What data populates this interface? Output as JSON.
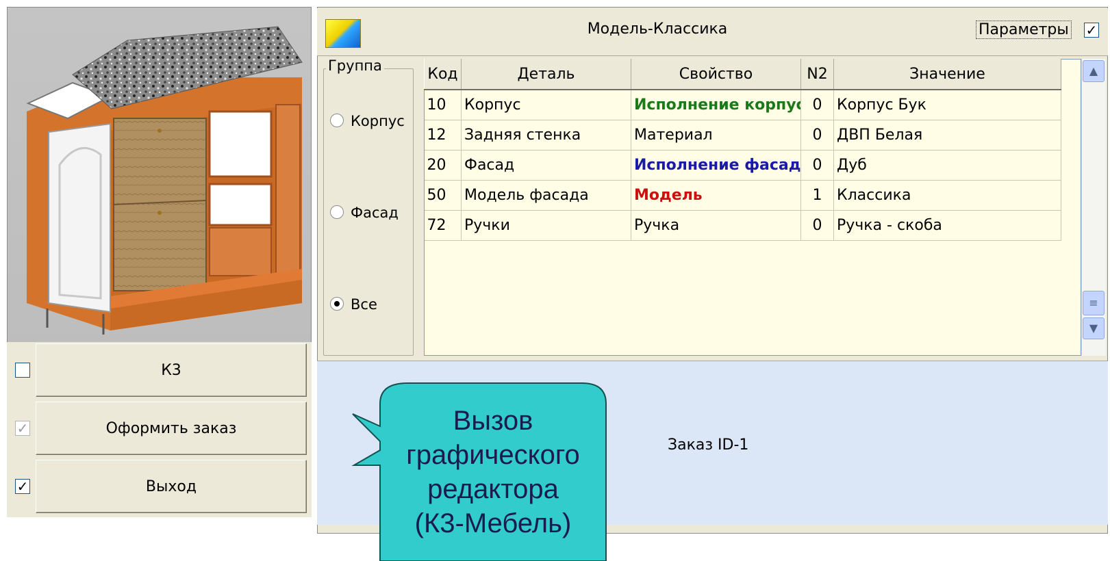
{
  "window": {
    "title": "Модель-Классика",
    "params_label": "Параметры",
    "params_checked": true
  },
  "group": {
    "legend": "Группа",
    "options": [
      {
        "label": "Корпус",
        "selected": false
      },
      {
        "label": "Фасад",
        "selected": false
      },
      {
        "label": "Все",
        "selected": true
      }
    ]
  },
  "table": {
    "headers": [
      "Код",
      "Деталь",
      "Свойство",
      "N2",
      "Значение"
    ],
    "rows": [
      {
        "code": "10",
        "detail": "Корпус",
        "property": "Исполнение корпуса",
        "n2": "0",
        "value": "Корпус Бук",
        "property_color": "#1a7a1a"
      },
      {
        "code": "12",
        "detail": "Задняя стенка",
        "property": "Материал",
        "n2": "0",
        "value": "ДВП Белая",
        "property_color": "#000000"
      },
      {
        "code": "20",
        "detail": "Фасад",
        "property": "Исполнение фасада",
        "n2": "0",
        "value": "Дуб",
        "property_color": "#1a1aa8"
      },
      {
        "code": "50",
        "detail": "Модель фасада",
        "property": "Модель",
        "n2": "1",
        "value": "Классика",
        "property_color": "#cc1010"
      },
      {
        "code": "72",
        "detail": "Ручки",
        "property": "Ручка",
        "n2": "0",
        "value": "Ручка - скоба",
        "property_color": "#000000"
      }
    ]
  },
  "buttons": {
    "k3": {
      "label": "К3",
      "checked": false,
      "enabled": true
    },
    "order": {
      "label": "Оформить заказ",
      "checked": true,
      "enabled": false
    },
    "exit": {
      "label": "Выход",
      "checked": true,
      "enabled": true
    }
  },
  "info": {
    "order_text": "Заказ ID-1"
  },
  "callout": {
    "lines": [
      "Вызов",
      "графического",
      "редактора",
      "(К3-Мебель)"
    ],
    "color": "#33cccc"
  },
  "icons": {
    "app": "app-logo-icon",
    "scroll_up": "chevron-up-icon",
    "scroll_down": "chevron-down-icon",
    "scroll_grip": "scroll-grip-icon"
  }
}
